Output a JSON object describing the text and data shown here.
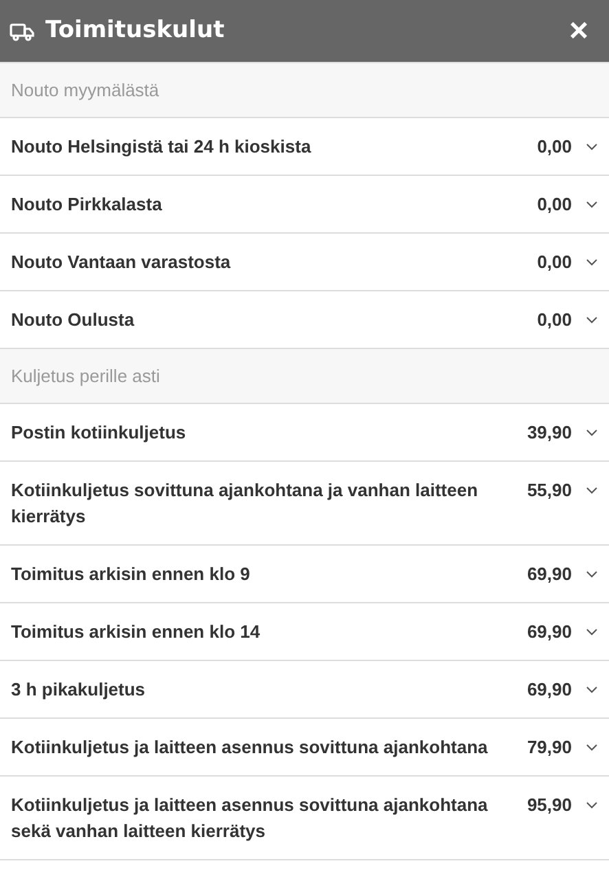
{
  "header": {
    "title": "Toimituskulut",
    "close": "×"
  },
  "sections": [
    {
      "title": "Nouto myymälästä",
      "options": [
        {
          "name": "Nouto Helsingistä tai 24 h kioskista",
          "price": "0,00",
          "expanded": false
        },
        {
          "name": "Nouto Pirkkalasta",
          "price": "0,00",
          "expanded": false
        },
        {
          "name": "Nouto Vantaan varastosta",
          "price": "0,00",
          "expanded": false
        },
        {
          "name": "Nouto Oulusta",
          "price": "0,00",
          "expanded": false
        }
      ]
    },
    {
      "title": "Kuljetus perille asti",
      "options": [
        {
          "name": "Postin kotiinkuljetus",
          "price": "39,90",
          "expanded": false
        },
        {
          "name": "Kotiinkuljetus sovittuna ajankohtana ja vanhan laitteen kierrätys",
          "price": "55,90",
          "expanded": false
        },
        {
          "name": "Toimitus arkisin ennen klo 9",
          "price": "69,90",
          "expanded": false
        },
        {
          "name": "Toimitus arkisin ennen klo 14",
          "price": "69,90",
          "expanded": false
        },
        {
          "name": "3 h pikakuljetus",
          "price": "69,90",
          "expanded": false
        },
        {
          "name": "Kotiinkuljetus ja laitteen asennus sovittuna ajankohtana",
          "price": "79,90",
          "expanded": false
        },
        {
          "name": "Kotiinkuljetus ja laitteen asennus sovittuna ajankohtana sekä vanhan laitteen kierrätys",
          "price": "95,90",
          "expanded": false
        }
      ]
    }
  ]
}
